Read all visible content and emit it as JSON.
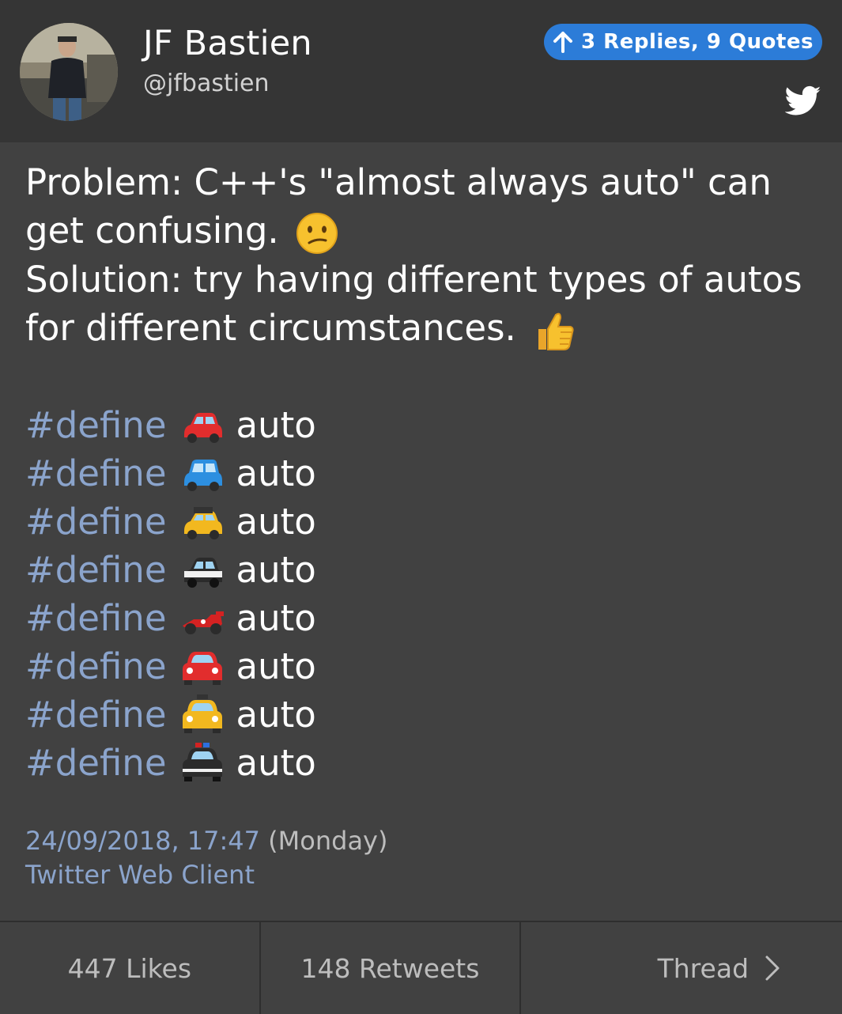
{
  "header": {
    "name": "JF Bastien",
    "handle": "@jfbastien",
    "replies_label": "3 Replies, 9 Quotes",
    "avatar_icon": "user-avatar-photo",
    "twitter_icon": "twitter-bird-icon",
    "accent_color": "#2c7cd8"
  },
  "tweet": {
    "line1": "Problem: C++'s \"almost always auto\" can get confusing.",
    "line1_emoji": "confused-face-emoji",
    "line2": "Solution: try having different types of autos for different circumstances.",
    "line2_emoji": "thumbs-up-emoji",
    "defines": [
      {
        "keyword": "#define",
        "car": "red-car-emoji",
        "word": "auto"
      },
      {
        "keyword": "#define",
        "car": "blue-car-emoji",
        "word": "auto"
      },
      {
        "keyword": "#define",
        "car": "taxi-emoji",
        "word": "auto"
      },
      {
        "keyword": "#define",
        "car": "police-car-emoji",
        "word": "auto"
      },
      {
        "keyword": "#define",
        "car": "racing-car-emoji",
        "word": "auto"
      },
      {
        "keyword": "#define",
        "car": "oncoming-automobile-emoji",
        "word": "auto"
      },
      {
        "keyword": "#define",
        "car": "oncoming-taxi-emoji",
        "word": "auto"
      },
      {
        "keyword": "#define",
        "car": "oncoming-police-car-emoji",
        "word": "auto"
      }
    ],
    "link_color": "#8ba4cc"
  },
  "meta": {
    "date": "24/09/2018, 17:47",
    "weekday": "(Monday)",
    "client": "Twitter Web Client"
  },
  "footer": {
    "likes": "447 Likes",
    "retweets": "148 Retweets",
    "thread": "Thread"
  }
}
